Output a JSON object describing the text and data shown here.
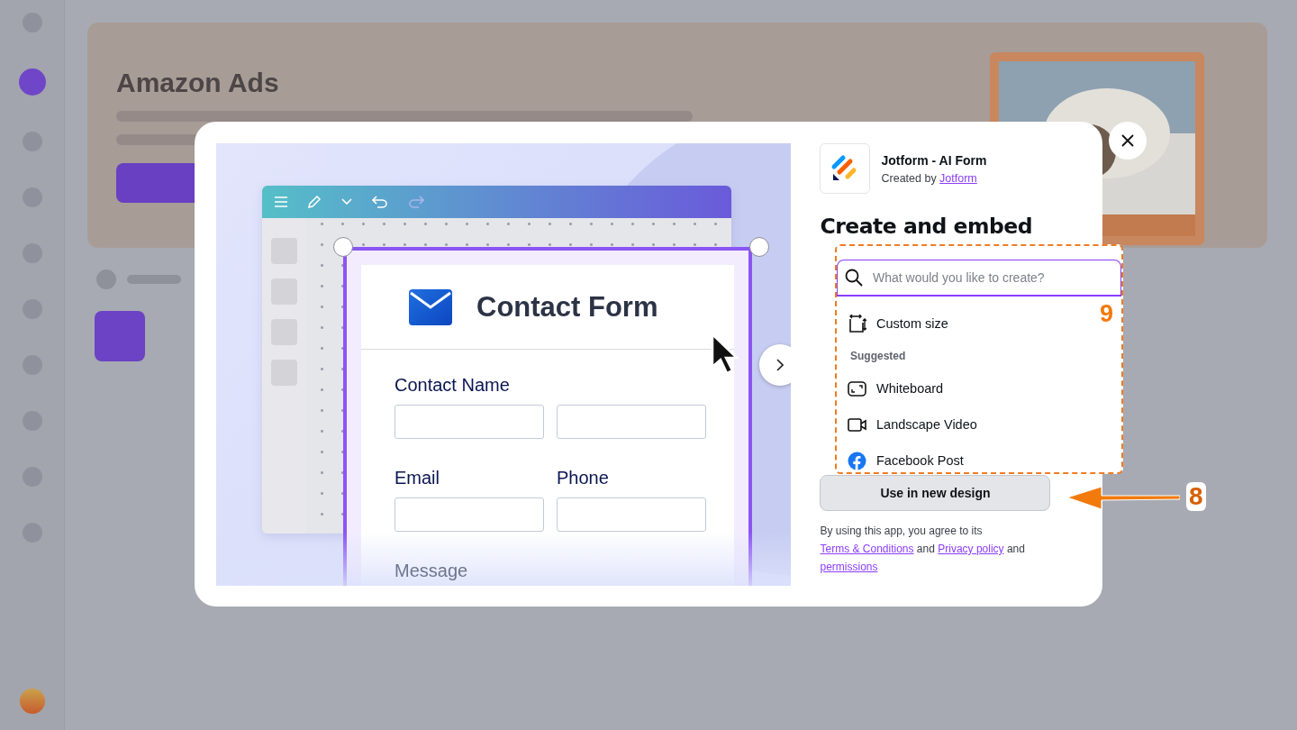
{
  "background": {
    "banner_title": "Amazon Ads"
  },
  "preview": {
    "form_title": "Contact Form",
    "rows": [
      {
        "fields": [
          {
            "label": "Contact Name",
            "kind": "double"
          }
        ]
      },
      {
        "fields": [
          {
            "label": "Email",
            "kind": "single"
          },
          {
            "label": "Phone",
            "kind": "single"
          }
        ]
      },
      {
        "fields": [
          {
            "label": "Message",
            "kind": "faded"
          }
        ]
      }
    ]
  },
  "app": {
    "name": "Jotform - AI Form",
    "created_by": "Created by",
    "author": "Jotform"
  },
  "heading": "Create and embed",
  "create_menu": {
    "placeholder": "What would you like to create?",
    "items": [
      {
        "label": "Custom size",
        "kind": "option"
      },
      {
        "label": "Suggested",
        "kind": "section"
      },
      {
        "label": "Whiteboard",
        "kind": "option"
      },
      {
        "label": "Landscape Video",
        "kind": "option"
      },
      {
        "label": "Facebook Post",
        "kind": "option"
      }
    ]
  },
  "primary_button": "Use in new design",
  "terms": [
    {
      "text": "By using this app, you agree to its ",
      "kind": "text"
    },
    {
      "text": "Terms & Conditions",
      "kind": "link"
    },
    {
      "text": " and ",
      "kind": "text"
    },
    {
      "text": "Privacy policy",
      "kind": "link"
    },
    {
      "text": " and ",
      "kind": "text"
    },
    {
      "text": "permissions",
      "kind": "link"
    }
  ],
  "annotations": [
    {
      "label": "9",
      "kind": "badge"
    },
    {
      "label": "8",
      "kind": "arrow"
    }
  ]
}
